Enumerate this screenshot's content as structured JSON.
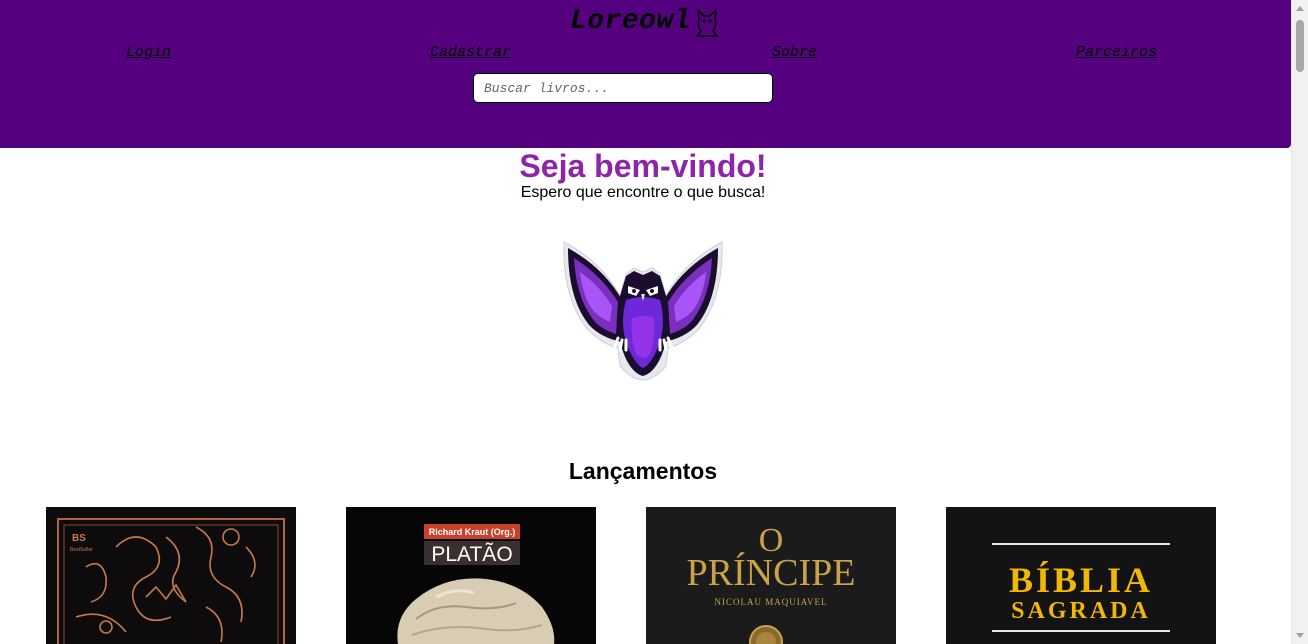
{
  "header": {
    "brand": "Loreowl",
    "brand_icon": "owl-outline-icon",
    "nav": [
      {
        "label": "Login"
      },
      {
        "label": "Cadastrar"
      },
      {
        "label": "Sobre"
      },
      {
        "label": "Parceiros"
      }
    ],
    "search": {
      "placeholder": "Buscar livros...",
      "value": ""
    },
    "background": "#55007f"
  },
  "welcome": {
    "title": "Seja bem-vindo!",
    "subtitle": "Espero que encontre o que busca!",
    "title_color": "#8e24aa",
    "logo_icon": "purple-owl-mascot-icon"
  },
  "releases": {
    "title": "Lançamentos",
    "books": [
      {
        "cover_text_1": "BS",
        "cover_text_2": "BestSeller"
      },
      {
        "cover_text_1": "Richard Kraut (Org.)",
        "cover_text_2": "PLATÃO"
      },
      {
        "cover_text_1": "O",
        "cover_text_2": "PRÍNCIPE",
        "cover_text_3": "NICOLAU MAQUIAVEL"
      },
      {
        "cover_text_1": "BÍBLIA",
        "cover_text_2": "SAGRADA"
      }
    ]
  }
}
